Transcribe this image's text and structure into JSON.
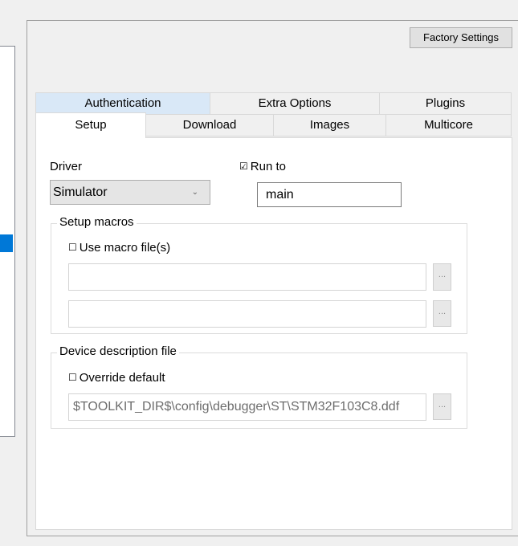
{
  "toolbar": {
    "factory_settings_label": "Factory Settings"
  },
  "tabs": {
    "row1": [
      {
        "label": "Authentication"
      },
      {
        "label": "Extra Options"
      },
      {
        "label": "Plugins"
      }
    ],
    "row2": [
      {
        "label": "Setup",
        "active": true
      },
      {
        "label": "Download"
      },
      {
        "label": "Images"
      },
      {
        "label": "Multicore"
      }
    ]
  },
  "setup": {
    "driver_label": "Driver",
    "driver_value": "Simulator",
    "run_to_label": "Run to",
    "run_to_checked": true,
    "run_to_value": "main",
    "macros_group_title": "Setup macros",
    "use_macro_label": "Use macro file(s)",
    "use_macro_checked": false,
    "macro_file_1": "",
    "macro_file_2": "",
    "browse_label": "...",
    "device_group_title": "Device description file",
    "override_label": "Override default",
    "override_checked": false,
    "device_file_value": "$TOOLKIT_DIR$\\config\\debugger\\ST\\STM32F103C8.ddf"
  },
  "icons": {
    "checkbox_checked": "☑",
    "checkbox_unchecked": "☐",
    "chevron": "⌄"
  },
  "colors": {
    "selection_blue": "#0078d7",
    "tab_highlight": "#d9e8f7",
    "panel_bg": "#ffffff",
    "window_bg": "#f0f0f0"
  }
}
